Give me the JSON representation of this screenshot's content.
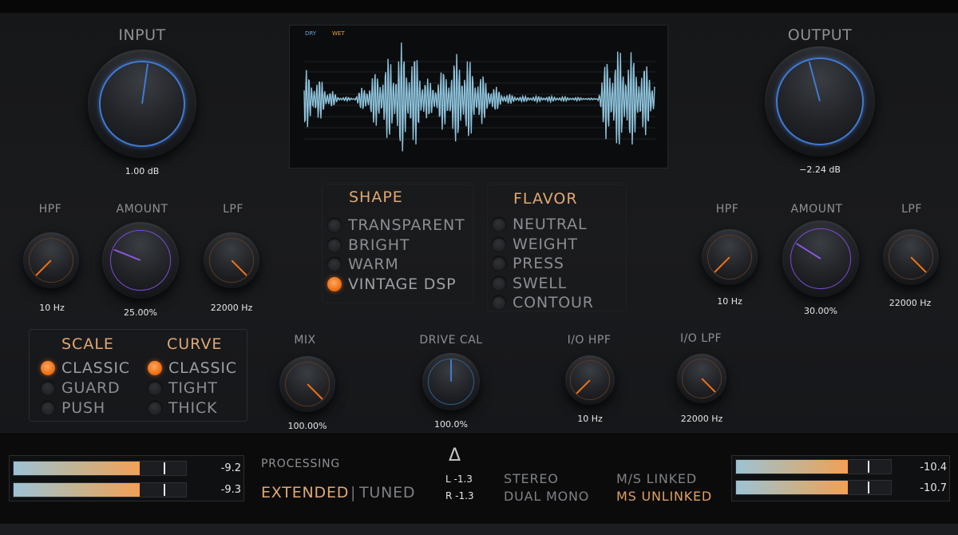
{
  "input": {
    "label": "INPUT",
    "value": "1.00 dB"
  },
  "output": {
    "label": "OUTPUT",
    "value": "−2.24 dB"
  },
  "scope": {
    "dry_label": "DRY",
    "wet_label": "WET"
  },
  "left_filter": {
    "hpf": {
      "label": "HPF",
      "value": "10 Hz"
    },
    "amount": {
      "label": "AMOUNT",
      "value": "25.00%"
    },
    "lpf": {
      "label": "LPF",
      "value": "22000 Hz"
    }
  },
  "right_filter": {
    "hpf": {
      "label": "HPF",
      "value": "10 Hz"
    },
    "amount": {
      "label": "AMOUNT",
      "value": "30.00%"
    },
    "lpf": {
      "label": "LPF",
      "value": "22000 Hz"
    }
  },
  "shape": {
    "title": "SHAPE",
    "options": [
      "TRANSPARENT",
      "BRIGHT",
      "WARM",
      "VINTAGE DSP"
    ],
    "selected": "VINTAGE DSP"
  },
  "flavor": {
    "title": "FLAVOR",
    "options": [
      "NEUTRAL",
      "WEIGHT",
      "PRESS",
      "SWELL",
      "CONTOUR"
    ],
    "selected": ""
  },
  "scale": {
    "title": "SCALE",
    "options": [
      "CLASSIC",
      "GUARD",
      "PUSH"
    ],
    "selected": "CLASSIC"
  },
  "curve": {
    "title": "CURVE",
    "options": [
      "CLASSIC",
      "TIGHT",
      "THICK"
    ],
    "selected": "CLASSIC"
  },
  "mix": {
    "label": "MIX",
    "value": "100.00%"
  },
  "drive_cal": {
    "label": "DRIVE CAL",
    "value": "100.0%"
  },
  "io_hpf": {
    "label": "I/O HPF",
    "value": "10 Hz"
  },
  "io_lpf": {
    "label": "I/O LPF",
    "value": "22000 Hz"
  },
  "footer": {
    "processing_label": "PROCESSING",
    "extended": "EXTENDED",
    "separator": "|",
    "tuned": "TUNED",
    "delta": "Δ",
    "delta_l": "L -1.3",
    "delta_r": "R -1.3",
    "stereo": "STEREO",
    "dual_mono": "DUAL MONO",
    "ms_linked": "M/S LINKED",
    "ms_unlinked": "MS UNLINKED",
    "input_meter": {
      "l": "-9.2",
      "r": "-9.3",
      "l_level": 0.73,
      "r_level": 0.73
    },
    "output_meter": {
      "l": "-10.4",
      "r": "-10.7",
      "l_level": 0.72,
      "r_level": 0.72
    }
  },
  "colors": {
    "accent_orange": "#f07116",
    "knob_ring_blue": "#3f7ad6",
    "knob_ring_purple": "#7a4bd0",
    "waveform": "#8ec3dc",
    "meter_gradient_start": "#9dc3d5",
    "meter_gradient_end": "#f2a055"
  }
}
